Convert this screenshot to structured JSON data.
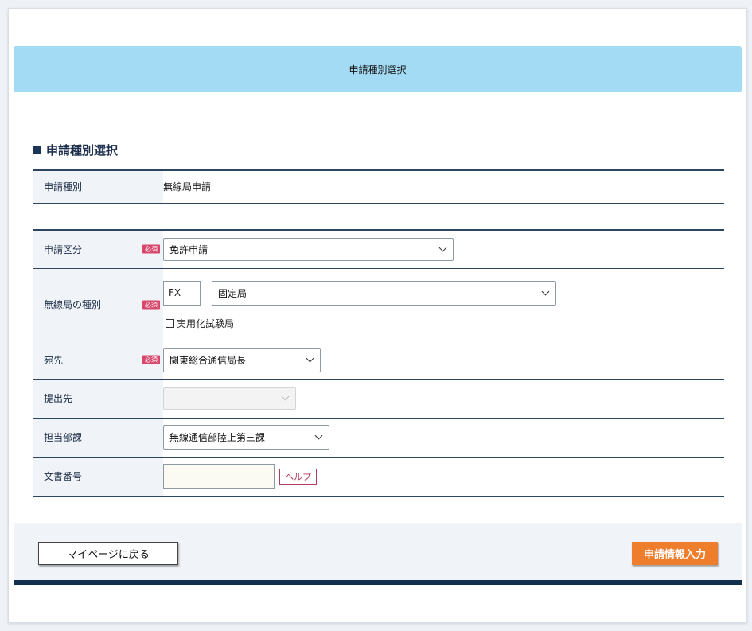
{
  "banner": {
    "title": "申請種別選択"
  },
  "section": {
    "title": "申請種別選択"
  },
  "type_table": {
    "label": "申請種別",
    "value": "無線局申請"
  },
  "form": {
    "required_badge": "必須",
    "application_category": {
      "label": "申請区分",
      "selected": "免許申請"
    },
    "station_type": {
      "label": "無線局の種別",
      "code": "FX",
      "selected": "固定局",
      "checkbox_label": "実用化試験局",
      "checkbox_checked": false
    },
    "destination": {
      "label": "宛先",
      "selected": "関東総合通信局長"
    },
    "submit_to": {
      "label": "提出先",
      "selected": ""
    },
    "department": {
      "label": "担当部課",
      "selected": "無線通信部陸上第三課"
    },
    "document_number": {
      "label": "文書番号",
      "value": "",
      "help_label": "ヘルプ"
    }
  },
  "footer": {
    "back_label": "マイページに戻る",
    "next_label": "申請情報入力"
  },
  "colors": {
    "banner": "#a4dbf4",
    "navy": "#1d3556",
    "required": "#d8466b",
    "primary_button": "#ee7d2c"
  }
}
